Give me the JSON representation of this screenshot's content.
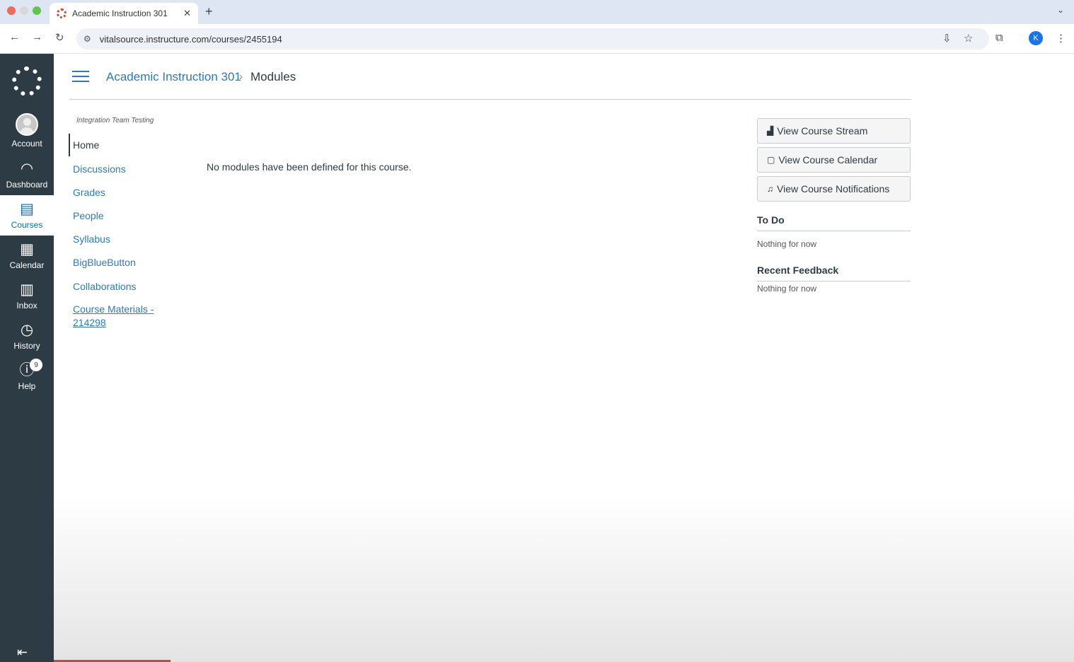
{
  "browser": {
    "tab_title": "Academic Instruction 301",
    "url": "vitalsource.instructure.com/courses/2455194",
    "profile_initial": "K"
  },
  "global_nav": {
    "items": [
      {
        "label": "Account"
      },
      {
        "label": "Dashboard"
      },
      {
        "label": "Courses"
      },
      {
        "label": "Calendar"
      },
      {
        "label": "Inbox"
      },
      {
        "label": "History"
      },
      {
        "label": "Help"
      }
    ],
    "help_badge": "9"
  },
  "breadcrumb": {
    "course": "Academic Instruction 301",
    "separator": "›",
    "current": "Modules"
  },
  "course_nav": {
    "term": "Integration Team Testing",
    "items": [
      {
        "label": "Home"
      },
      {
        "label": "Discussions"
      },
      {
        "label": "Grades"
      },
      {
        "label": "People"
      },
      {
        "label": "Syllabus"
      },
      {
        "label": "BigBlueButton"
      },
      {
        "label": "Collaborations"
      },
      {
        "label": "Course Materials - 214298"
      }
    ]
  },
  "main": {
    "empty_message": "No modules have been defined for this course."
  },
  "sidebar": {
    "buttons": [
      {
        "label": "View Course Stream",
        "icon": "chart-icon"
      },
      {
        "label": "View Course Calendar",
        "icon": "calendar-icon"
      },
      {
        "label": "View Course Notifications",
        "icon": "bell-icon"
      }
    ],
    "todo": {
      "heading": "To Do",
      "note": "Nothing for now"
    },
    "feedback": {
      "heading": "Recent Feedback",
      "note": "Nothing for now"
    }
  },
  "colors": {
    "nav_bg": "#2d3b45",
    "link": "#2b7abc",
    "text": "#2d3b45"
  }
}
